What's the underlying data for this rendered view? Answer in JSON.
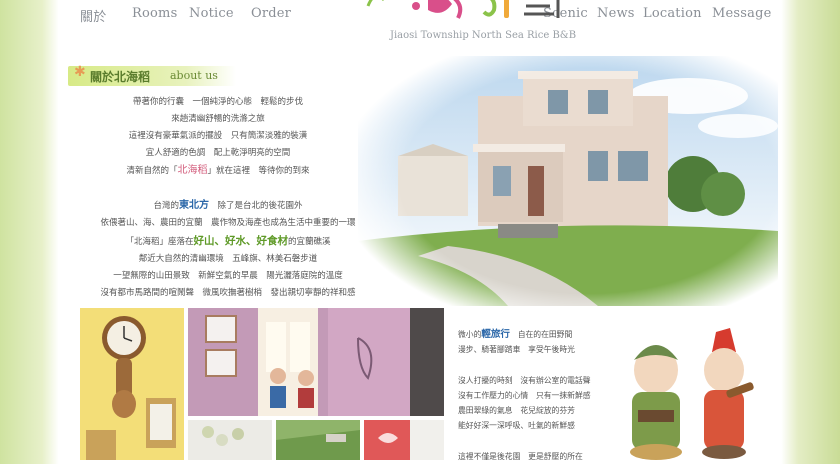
{
  "nav": {
    "left": [
      "關於",
      "Rooms",
      "Notice",
      "Order"
    ],
    "right": [
      "Scenic",
      "News",
      "Location",
      "Message"
    ]
  },
  "header": {
    "tagline": "Jiaosi Township North Sea Rice B&B"
  },
  "about": {
    "title": "關於北海稻",
    "title_en": "about us",
    "lines": [
      "帶著你的行囊　一個純淨的心態　輕鬆的步伐",
      "來趟清幽舒暢的洗滌之旅",
      "這裡沒有豪華氣派的擺設　只有簡潔淡雅的裝潢",
      "宜人舒適的色調　配上乾淨明亮的空間"
    ],
    "welcome_prefix": "清新自然的「",
    "welcome_name": "北海稻",
    "welcome_suffix": "」就在這裡　等待你的到來"
  },
  "location_text": {
    "l1_prefix": "台灣的",
    "l1_em": "東北方",
    "l1_suffix": "　除了是台北的後花園外",
    "l2": "依偎著山、海、農田的宜蘭　農作物及海產也成為生活中重要的一環",
    "l3_prefix": "「北海稻」座落在",
    "l3_em": "好山、好水、好食材",
    "l3_suffix": "的宜蘭礁溪",
    "l4": "鄰近大自然的清幽環境　五峰旗、林美石磐步道",
    "l5": "一望無際的山田景致　新鮮空氣的早晨　陽光灑落庭院的溫度",
    "l6": "沒有都市馬路間的喧鬧聲　微風吹撫著樹梢　發出親切寧靜的祥和感"
  },
  "travel_text": {
    "l1_prefix": "微小的",
    "l1_em": "輕旅行",
    "l1_suffix": "　自在的在田野間",
    "l2": "漫步、騎著腳踏車　享受午後時光",
    "l3": "沒人打擾的時刻　沒有辦公室的電話聲",
    "l4": "沒有工作壓力的心情　只有一抹新鮮感",
    "l5": "農田翠綠的氣息　花兒綻放的芬芳",
    "l6": "能好好深一深呼吸、吐氣的新鮮感",
    "l7": "這裡不僅是後花園　更是舒壓的所在"
  },
  "colors": {
    "nav_text": "#8a8f96",
    "accent_green": "#5f9a28",
    "accent_blue": "#2a66a8",
    "accent_pink": "#d25a7a"
  }
}
